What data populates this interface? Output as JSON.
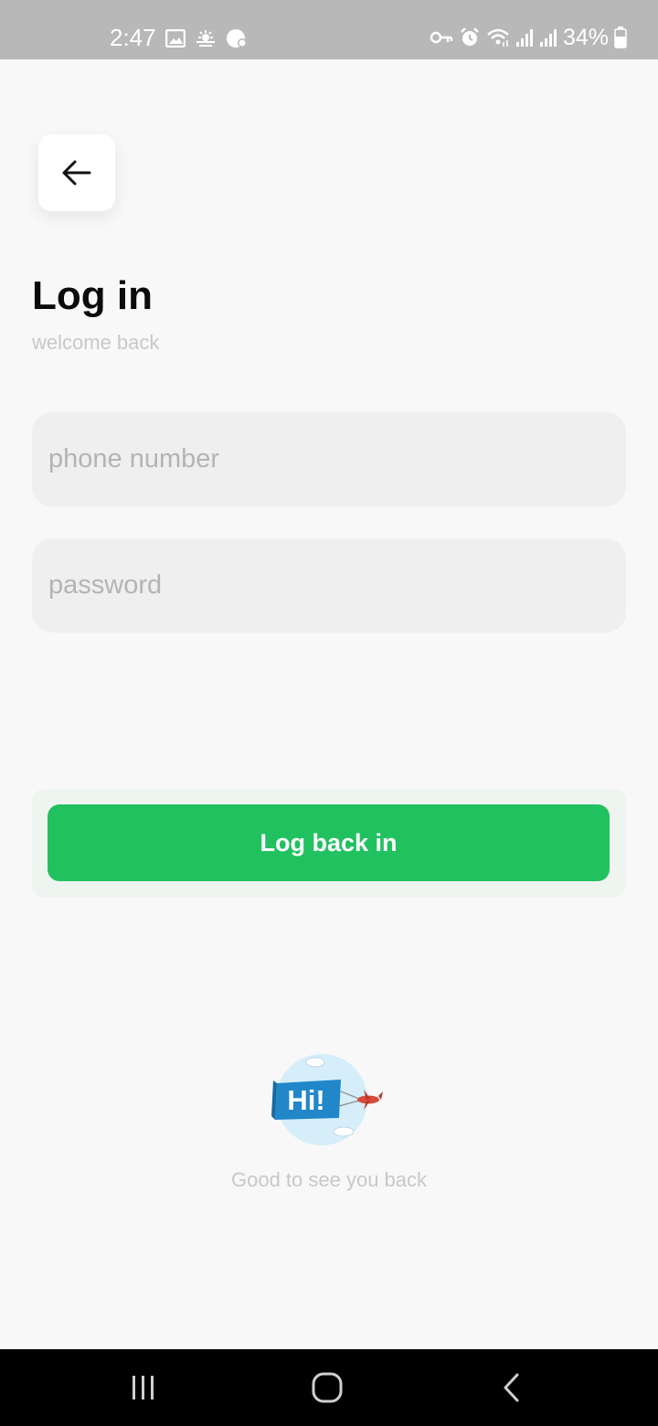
{
  "status_bar": {
    "time": "2:47",
    "battery": "34%",
    "left_icons": [
      "image-icon",
      "weather-icon",
      "app-badge-icon"
    ],
    "right_icons": [
      "vpn-key-icon",
      "alarm-icon",
      "wifi-icon",
      "signal-icon",
      "signal-icon",
      "battery-icon"
    ]
  },
  "header": {
    "back_icon": "arrow-left-icon",
    "title": "Log in",
    "subtitle": "welcome back"
  },
  "form": {
    "phone_placeholder": "phone number",
    "phone_value": "",
    "password_placeholder": "password",
    "password_value": "",
    "submit_label": "Log back in"
  },
  "footer": {
    "illustration_text": "Hi!",
    "message": "Good to see you back"
  },
  "colors": {
    "accent": "#22c160",
    "background": "#f8f8f9",
    "field_bg": "#efefef",
    "status_bar": "#b8b8b8"
  },
  "nav_bar": {
    "buttons": [
      "recents-icon",
      "home-icon",
      "back-icon"
    ]
  }
}
